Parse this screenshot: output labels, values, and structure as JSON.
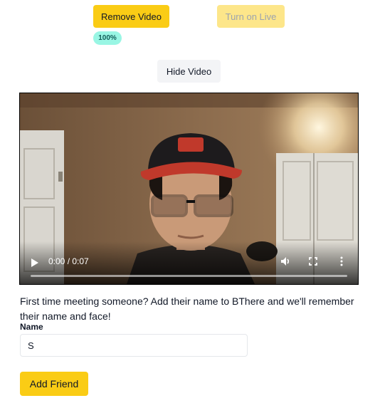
{
  "toolbar": {
    "remove_video_label": "Remove Video",
    "turn_on_live_label": "Turn on Live",
    "progress_badge": "100%",
    "hide_video_label": "Hide Video"
  },
  "video": {
    "time_display": "0:00 / 0:07",
    "controls": [
      "play-icon",
      "volume-icon",
      "fullscreen-icon",
      "more-options-icon"
    ]
  },
  "form": {
    "intro_text": "First time meeting someone? Add their name to BThere and we'll remember their name and face!",
    "name_label": "Name",
    "name_value": "S",
    "submit_label": "Add Friend"
  },
  "colors": {
    "primary": "#facc15",
    "primary_disabled": "#fde68a",
    "badge": "#99f6e4"
  }
}
